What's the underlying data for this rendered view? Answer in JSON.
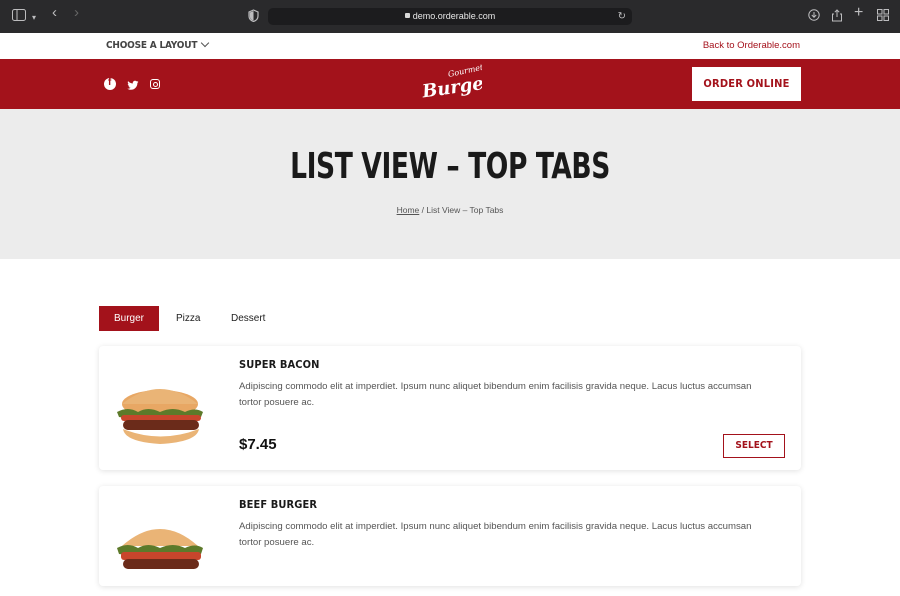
{
  "browser": {
    "url": "demo.orderable.com",
    "icons": [
      "sidebar-icon",
      "chevron-down-icon",
      "back-icon",
      "forward-icon",
      "shield-icon",
      "lock-icon",
      "reload-icon",
      "download-icon",
      "share-icon",
      "plus-icon",
      "tabs-grid-icon"
    ]
  },
  "utility": {
    "layout_label": "CHOOSE A LAYOUT",
    "back_link": "Back to Orderable.com"
  },
  "header": {
    "logo_script": "Burger",
    "logo_small": "Gourmet",
    "order_label": "ORDER ONLINE",
    "social": [
      "facebook-icon",
      "twitter-icon",
      "instagram-icon"
    ]
  },
  "hero": {
    "title": "LIST VIEW – TOP TABS",
    "crumb_home": "Home",
    "crumb_sep": " / ",
    "crumb_current": "List View – Top Tabs"
  },
  "tabs": [
    {
      "label": "Burger",
      "active": true
    },
    {
      "label": "Pizza",
      "active": false
    },
    {
      "label": "Dessert",
      "active": false
    }
  ],
  "products": [
    {
      "name": "SUPER BACON",
      "description": "Adipiscing commodo elit at imperdiet. Ipsum nunc aliquet bibendum enim facilisis gravida neque. Lacus luctus accumsan tortor posuere ac.",
      "price": "$7.45",
      "select_label": "SELECT"
    },
    {
      "name": "BEEF BURGER",
      "description": "Adipiscing commodo elit at imperdiet. Ipsum nunc aliquet bibendum enim facilisis gravida neque. Lacus luctus accumsan tortor posuere ac."
    }
  ],
  "colors": {
    "brand_red": "#a3121b",
    "hero_bg": "#ececec",
    "chrome_bg": "#2a2a2c"
  }
}
